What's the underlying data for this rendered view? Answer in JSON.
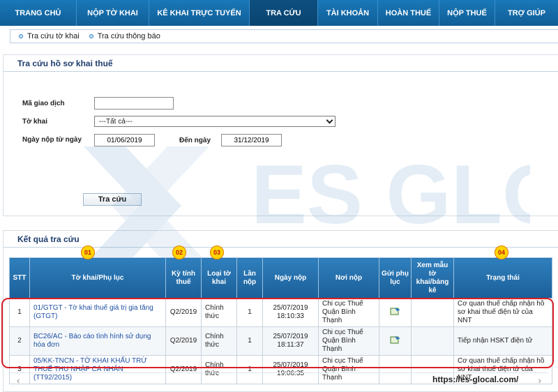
{
  "nav": {
    "items": [
      {
        "label": "TRANG CHỦ",
        "active": false
      },
      {
        "label": "NỘP TỜ KHAI",
        "active": false
      },
      {
        "label": "KÊ KHAI TRỰC TUYẾN",
        "active": false
      },
      {
        "label": "TRA CỨU",
        "active": true
      },
      {
        "label": "TÀI KHOẢN",
        "active": false
      },
      {
        "label": "HOÀN THUẾ",
        "active": false
      },
      {
        "label": "NỘP THUẾ",
        "active": false
      },
      {
        "label": "TRỢ GIÚP",
        "active": false
      }
    ]
  },
  "subnav": {
    "items": [
      "Tra cứu tờ khai",
      "Tra cứu thông báo"
    ]
  },
  "search_panel": {
    "title": "Tra cứu hồ sơ khai thuế",
    "ma_giao_dich_label": "Mã giao dịch",
    "ma_giao_dich_value": "",
    "to_khai_label": "Tờ khai",
    "to_khai_selected": "---Tất cả---",
    "ngay_nop_tu_label": "Ngày nộp từ ngày",
    "ngay_nop_tu_value": "01/06/2019",
    "den_ngay_label": "Đến ngày",
    "den_ngay_value": "31/12/2019",
    "search_button": "Tra cứu"
  },
  "results_panel": {
    "title": "Kết quả tra cứu",
    "headers": [
      "STT",
      "Tờ khai/Phụ lục",
      "Kỳ tính thuế",
      "Loại tờ khai",
      "Lần nộp",
      "Ngày nộp",
      "Nơi nộp",
      "Gửi phụ lục",
      "Xem mẫu tờ khai/bảng kê",
      "Trạng thái"
    ],
    "badges": [
      "01",
      "02",
      "03",
      "04"
    ],
    "rows": [
      {
        "stt": "1",
        "to_khai": "01/GTGT - Tờ khai thuế giá trị gia tăng (GTGT)",
        "ky": "Q2/2019",
        "loai": "Chính thức",
        "lan": "1",
        "ngay": "25/07/2019 18:10:33",
        "noi": "Chi cục Thuế Quận Bình Thạnh",
        "gui": true,
        "trang_thai": "Cơ quan thuế chấp nhận hồ sơ khai thuế điện tử của NNT"
      },
      {
        "stt": "2",
        "to_khai": "BC26/AC - Báo cáo tình hình sử dụng hóa đơn",
        "ky": "Q2/2019",
        "loai": "Chính thức",
        "lan": "1",
        "ngay": "25/07/2019 18:11:37",
        "noi": "Chi cục Thuế Quận Bình Thạnh",
        "gui": true,
        "trang_thai": "Tiếp nhận HSKT điện tử"
      },
      {
        "stt": "3",
        "to_khai": "05/KK-TNCN - TỜ KHAI KHẤU TRỪ THUẾ THU NHẬP CÁ NHÂN (TT92/2015)",
        "ky": "Q2/2019",
        "loai": "Chính thức",
        "lan": "1",
        "ngay": "25/07/2019 19:06:35",
        "noi": "Chi cục Thuế Quận Bình Thạnh",
        "gui": false,
        "trang_thai": "Cơ quan thuế chấp nhận hồ sơ khai thuế điện tử của NNT"
      }
    ]
  },
  "watermark_text": "ES GLOCAL",
  "footer_url": "https://es-glocal.com/",
  "colors": {
    "nav": "#1a78b8",
    "nav_active": "#0d4f80",
    "header": "#2f7fbd",
    "highlight": "#d91f26",
    "badge": "#ffd500"
  }
}
